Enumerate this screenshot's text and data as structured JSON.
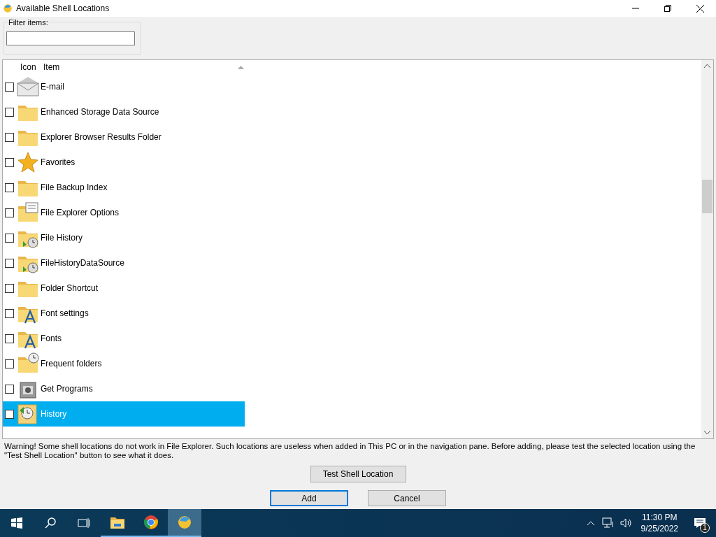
{
  "window": {
    "title": "Available Shell Locations"
  },
  "filter": {
    "label": "Filter items:"
  },
  "list": {
    "columns": [
      "Icon",
      "Item"
    ],
    "sort_ascending": true,
    "rows": [
      {
        "label": "E-mail",
        "kind": "envelope",
        "checked": false,
        "selected": false
      },
      {
        "label": "Enhanced Storage Data Source",
        "kind": "folder",
        "checked": false,
        "selected": false
      },
      {
        "label": "Explorer Browser Results Folder",
        "kind": "folder",
        "checked": false,
        "selected": false
      },
      {
        "label": "Favorites",
        "kind": "star",
        "checked": false,
        "selected": false
      },
      {
        "label": "File Backup Index",
        "kind": "folder",
        "checked": false,
        "selected": false
      },
      {
        "label": "File Explorer Options",
        "kind": "options",
        "checked": false,
        "selected": false
      },
      {
        "label": "File History",
        "kind": "clock",
        "checked": false,
        "selected": false
      },
      {
        "label": "FileHistoryDataSource",
        "kind": "clock",
        "checked": false,
        "selected": false
      },
      {
        "label": "Folder Shortcut",
        "kind": "folder",
        "checked": false,
        "selected": false
      },
      {
        "label": "Font settings",
        "kind": "font",
        "checked": false,
        "selected": false
      },
      {
        "label": "Fonts",
        "kind": "font",
        "checked": false,
        "selected": false
      },
      {
        "label": "Frequent folders",
        "kind": "frequent",
        "checked": false,
        "selected": false
      },
      {
        "label": "Get Programs",
        "kind": "programs",
        "checked": false,
        "selected": false
      },
      {
        "label": "History",
        "kind": "history",
        "checked": false,
        "selected": true
      }
    ]
  },
  "warning": "Warning! Some shell locations do not work in File Explorer. Such locations are useless when added in This PC or in the navigation pane. Before adding, please test the selected location using the \"Test Shell Location\" button to see what it does.",
  "buttons": {
    "test": "Test Shell Location",
    "add": "Add",
    "cancel": "Cancel"
  },
  "taskbar": {
    "apps": [
      {
        "kind": "explorer",
        "active": false
      },
      {
        "kind": "chrome",
        "active": false
      },
      {
        "kind": "app",
        "active": true
      }
    ],
    "time": "11:30 PM",
    "date": "9/25/2022",
    "notifications": "1"
  }
}
